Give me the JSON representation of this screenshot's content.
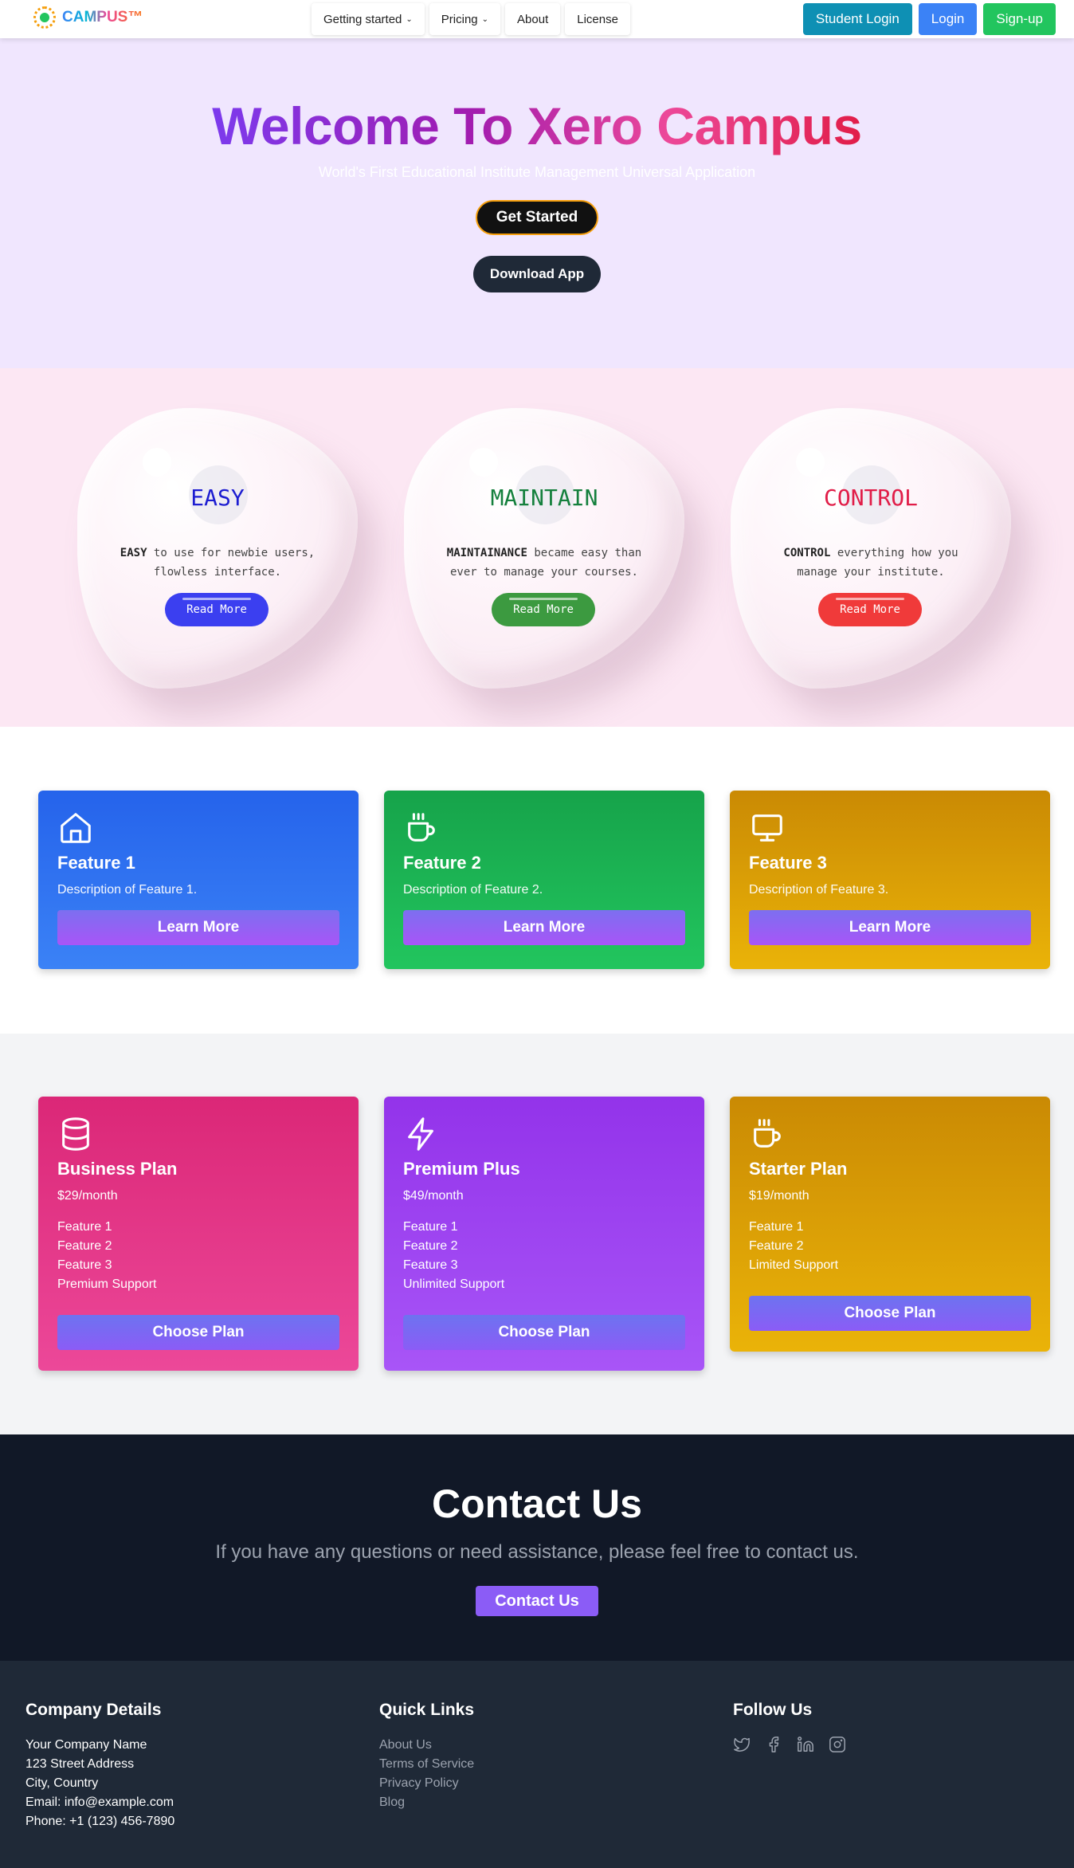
{
  "nav": {
    "logo_text": "CAMPUS™",
    "menu": [
      {
        "label": "Getting started",
        "dropdown": true
      },
      {
        "label": "Pricing",
        "dropdown": true
      },
      {
        "label": "About",
        "dropdown": false
      },
      {
        "label": "License",
        "dropdown": false
      }
    ],
    "student_login": "Student Login",
    "login": "Login",
    "signup": "Sign-up"
  },
  "hero": {
    "title": "Welcome To Xero Campus",
    "subtitle": "World's First Educational Institute Management Universal Application",
    "get_started": "Get Started",
    "download_app": "Download App"
  },
  "blobs": [
    {
      "title": "EASY",
      "title_color": "#1d1dd1",
      "bold": "EASY",
      "text": " to use for newbie users, flowless interface.",
      "button": "Read More",
      "button_color": "#3b3ff0"
    },
    {
      "title": "MAINTAIN",
      "title_color": "#15803d",
      "bold": "MAINTAINANCE",
      "text": " became easy than ever to manage your courses.",
      "button": "Read More",
      "button_color": "#3c9a40"
    },
    {
      "title": "CONTROL",
      "title_color": "#e11d48",
      "bold": "CONTROL",
      "text": " everything how you manage your institute.",
      "button": "Read More",
      "button_color": "#f03a3a"
    }
  ],
  "features": [
    {
      "icon": "home-icon",
      "title": "Feature 1",
      "description": "Description of Feature 1.",
      "button": "Learn More"
    },
    {
      "icon": "coffee-icon",
      "title": "Feature 2",
      "description": "Description of Feature 2.",
      "button": "Learn More"
    },
    {
      "icon": "monitor-icon",
      "title": "Feature 3",
      "description": "Description of Feature 3.",
      "button": "Learn More"
    }
  ],
  "plans": [
    {
      "icon": "database-icon",
      "title": "Business Plan",
      "price": "$29/month",
      "items": [
        "Feature 1",
        "Feature 2",
        "Feature 3",
        "Premium Support"
      ],
      "button": "Choose Plan"
    },
    {
      "icon": "lightning-icon",
      "title": "Premium Plus",
      "price": "$49/month",
      "items": [
        "Feature 1",
        "Feature 2",
        "Feature 3",
        "Unlimited Support"
      ],
      "button": "Choose Plan"
    },
    {
      "icon": "coffee-icon",
      "title": "Starter Plan",
      "price": "$19/month",
      "items": [
        "Feature 1",
        "Feature 2",
        "Limited Support"
      ],
      "button": "Choose Plan"
    }
  ],
  "contact": {
    "title": "Contact Us",
    "text": "If you have any questions or need assistance, please feel free to contact us.",
    "button": "Contact Us"
  },
  "footer": {
    "company_heading": "Company Details",
    "company_lines": [
      "Your Company Name",
      "123 Street Address",
      "City, Country",
      "Email: info@example.com",
      "Phone: +1 (123) 456-7890"
    ],
    "links_heading": "Quick Links",
    "links": [
      "About Us",
      "Terms of Service",
      "Privacy Policy",
      "Blog"
    ],
    "follow_heading": "Follow Us",
    "socials": [
      "twitter-icon",
      "facebook-icon",
      "linkedin-icon",
      "instagram-icon"
    ]
  }
}
